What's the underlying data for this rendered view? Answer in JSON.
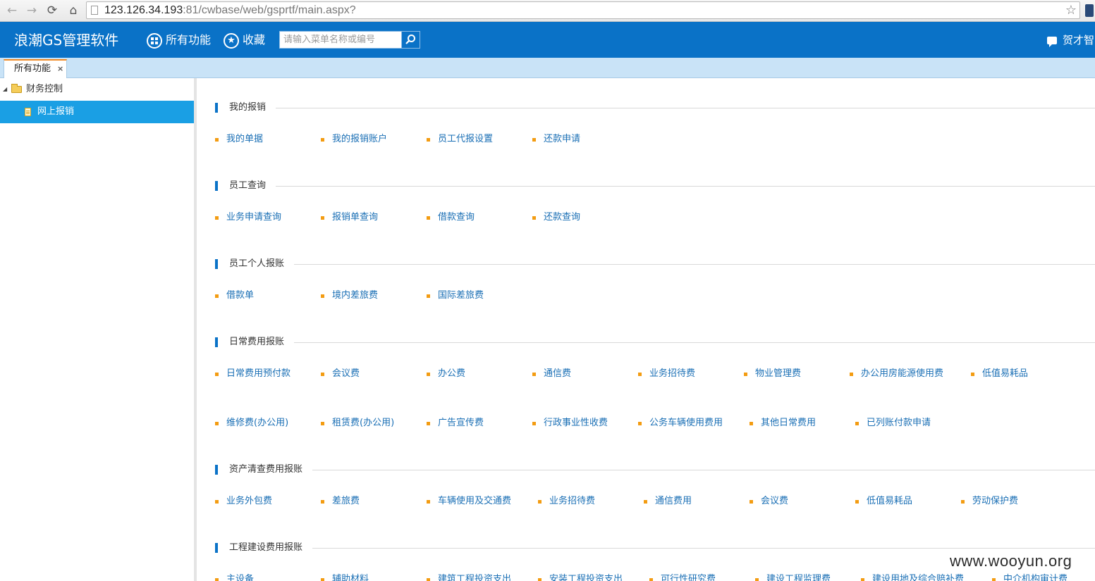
{
  "browser": {
    "url_host": "123.126.34.193",
    "url_rest": ":81/cwbase/web/gsprtf/main.aspx?"
  },
  "header": {
    "brand": "浪潮GS管理软件",
    "all_functions": "所有功能",
    "favorites": "收藏",
    "search_placeholder": "请输入菜单名称或编号",
    "user_name": "贺才智",
    "bg_color": "#0a72c7"
  },
  "tabs": [
    {
      "label": "所有功能",
      "close": "×"
    }
  ],
  "sidebar": {
    "root_label": "财务控制",
    "child_label": "网上报销",
    "child_bg": "#1a9fe4"
  },
  "sections": [
    {
      "title": "我的报销",
      "rows": [
        [
          "我的单据",
          "我的报销账户",
          "员工代报设置",
          "还款申请"
        ]
      ]
    },
    {
      "title": "员工查询",
      "rows": [
        [
          "业务申请查询",
          "报销单查询",
          "借款查询",
          "还款查询"
        ]
      ]
    },
    {
      "title": "员工个人报账",
      "rows": [
        [
          "借款单",
          "境内差旅费",
          "国际差旅费"
        ]
      ]
    },
    {
      "title": "日常费用报账",
      "rows": [
        [
          "日常费用预付款",
          "会议费",
          "办公费",
          "通信费",
          "业务招待费",
          "物业管理费",
          "办公用房能源使用费",
          "低值易耗品"
        ],
        [
          "维修费(办公用)",
          "租赁费(办公用)",
          "广告宣传费",
          "行政事业性收费",
          "公务车辆使用费用",
          "其他日常费用",
          "已列账付款申请"
        ]
      ]
    },
    {
      "title": "资产清查费用报账",
      "rows": [
        [
          "业务外包费",
          "差旅费",
          "车辆使用及交通费",
          "业务招待费",
          "通信费用",
          "会议费",
          "低值易耗品",
          "劳动保护费"
        ]
      ]
    },
    {
      "title": "工程建设费用报账",
      "rows": [
        [
          "主设备",
          "辅助材料",
          "建筑工程投资支出",
          "安装工程投资支出",
          "可行性研究费",
          "建设工程监理费",
          "建设用地及综合赔补费",
          "中介机构审计费"
        ]
      ]
    }
  ],
  "watermark": "www.wooyun.org",
  "colors": {
    "accent_orange": "#f39c12",
    "link_blue": "#1a6fb5"
  }
}
